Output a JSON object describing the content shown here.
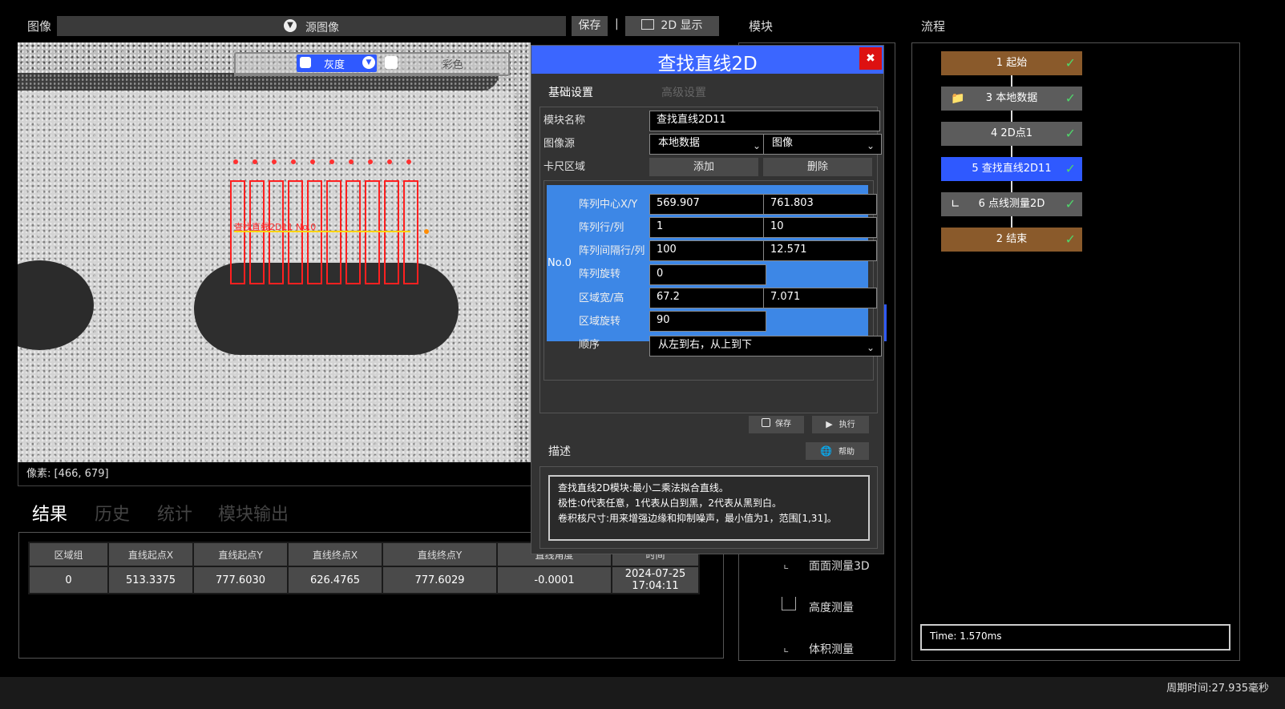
{
  "image_panel": {
    "title": "图像",
    "source_select": "源图像",
    "save_label": "保存",
    "separator": "|",
    "display_label": "2D 显示",
    "overlay": {
      "gray_label": "灰度",
      "color_label": "彩色"
    },
    "roi_label": "查找直线2D11 No.0",
    "pixel_readout": "像素: [466, 679]"
  },
  "results": {
    "tabs": [
      "结果",
      "历史",
      "统计",
      "模块输出"
    ],
    "columns": [
      "区域组",
      "直线起点X",
      "直线起点Y",
      "直线终点X",
      "直线终点Y",
      "直线角度",
      "时间"
    ],
    "rows": [
      [
        "0",
        "513.3375",
        "777.6030",
        "626.4765",
        "777.6029",
        "-0.0001",
        "2024-07-25 17:04:11"
      ]
    ]
  },
  "module_panel": {
    "title": "模块",
    "items": [
      "面面测量3D",
      "高度测量",
      "体积测量"
    ]
  },
  "flow_panel": {
    "title": "流程",
    "nodes": [
      {
        "label": "1 起始",
        "color": "#8a5a2b",
        "icon": ""
      },
      {
        "label": "3 本地数据",
        "color": "#5c5c5c",
        "icon": "folder-icon"
      },
      {
        "label": "4 2D点1",
        "color": "#5c5c5c",
        "icon": ""
      },
      {
        "label": "5 查找直线2D11",
        "color": "#2f59ff",
        "icon": ""
      },
      {
        "label": "6 点线测量2D",
        "color": "#5c5c5c",
        "icon": "angle-icon"
      },
      {
        "label": "2 结束",
        "color": "#8a5a2b",
        "icon": ""
      }
    ],
    "time": "Time: 1.570ms"
  },
  "dialog": {
    "title": "查找直线2D",
    "tab_basic": "基础设置",
    "tab_advanced": "高级设置",
    "module_name_label": "模块名称",
    "module_name_value": "查找直线2D11",
    "image_source_label": "图像源",
    "image_source_a": "本地数据",
    "image_source_b": "图像",
    "caliper_label": "卡尺区域",
    "add_label": "添加",
    "delete_label": "删除",
    "region_tag": "No.0",
    "fields": {
      "center_label": "阵列中心X/Y",
      "center_x": "569.907",
      "center_y": "761.803",
      "rowcol_label": "阵列行/列",
      "rows": "1",
      "cols": "10",
      "spacing_label": "阵列间隔行/列",
      "row_gap": "100",
      "col_gap": "12.571",
      "rotate_label": "阵列旋转",
      "rotate": "0",
      "size_label": "区域宽/高",
      "width": "67.2",
      "height": "7.071",
      "region_rotate_label": "区域旋转",
      "region_rotate": "90",
      "order_label": "顺序",
      "order_value": "从左到右，从上到下"
    },
    "save_label": "保存",
    "run_label": "执行",
    "desc_label": "描述",
    "help_label": "帮助",
    "desc_lines": [
      "查找直线2D模块:最小二乘法拟合直线。",
      "极性:0代表任意，1代表从白到黑，2代表从黑到白。",
      "卷积核尺寸:用来增强边缘和抑制噪声，最小值为1，范围[1,31]。"
    ]
  },
  "status_bar": {
    "cycle_time": "周期时间:27.935毫秒"
  }
}
